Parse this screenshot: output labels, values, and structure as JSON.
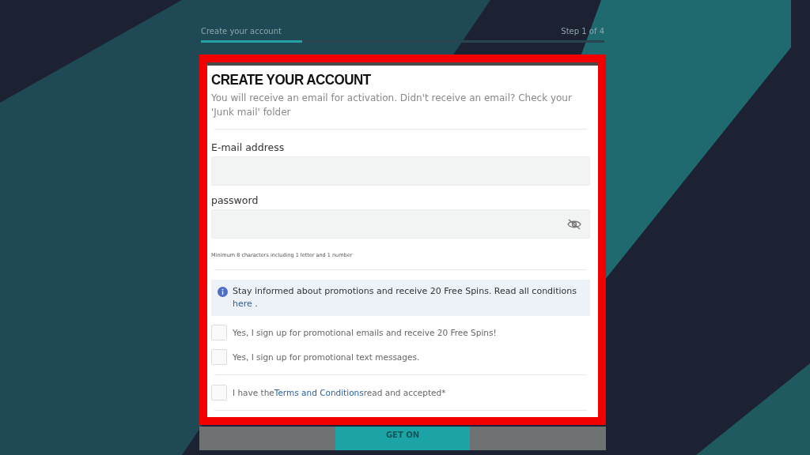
{
  "progress": {
    "label": "Create your account",
    "step": "Step 1 of 4",
    "level": 0.25
  },
  "form": {
    "title": "CREATE YOUR ACCOUNT",
    "subtitle": "You will receive an email for activation. Didn't receive an email? Check your 'Junk mail' folder",
    "fields": [
      {
        "label": "E-mail address",
        "kind": "text"
      },
      {
        "label": "password",
        "kind": "password",
        "hint": "Minimum 8 characters including 1 letter and 1 number"
      }
    ],
    "info": {
      "text": "Stay informed about promotions and receive 20 Free Spins. Read all conditions",
      "link": "here",
      "after": " ."
    },
    "options": [
      {
        "text": "Yes, I sign up for promotional emails and receive 20 Free Spins!",
        "checked": false
      },
      {
        "text": "Yes, I sign up for promotional text messages.",
        "checked": false
      }
    ],
    "terms": {
      "before": "I have the",
      "link": "Terms and Conditions",
      "after": "read and accepted*",
      "checked": false
    }
  },
  "submit": {
    "label": "GET ON"
  }
}
